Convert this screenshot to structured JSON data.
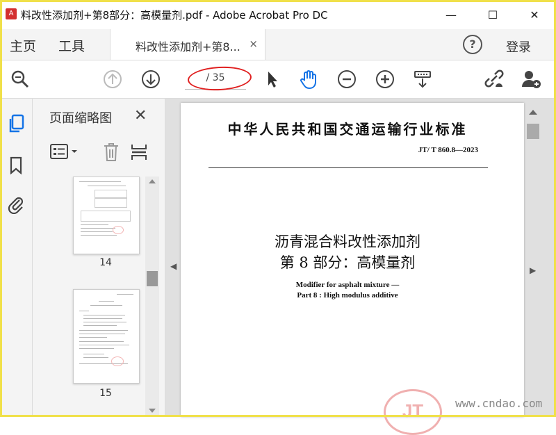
{
  "window": {
    "title": "料改性添加剂+第8部分：高模量剂.pdf - Adobe Acrobat Pro DC",
    "minimize": "—",
    "maximize": "☐",
    "close": "✕"
  },
  "tabs": {
    "home": "主页",
    "tools": "工具",
    "document": "料改性添加剂+第8...",
    "document_close": "×",
    "help": "?",
    "login": "登录"
  },
  "toolbar": {
    "page_indicator": "/ 35",
    "icons": [
      "search-icon",
      "prev-page-icon",
      "next-page-icon",
      "select-cursor-icon",
      "hand-tool-icon",
      "zoom-out-icon",
      "zoom-in-icon",
      "scroll-mode-icon",
      "share-link-icon",
      "add-user-icon"
    ],
    "highlight_color": "#e02020"
  },
  "sidebar": {
    "icons": [
      "page-thumbnails-icon",
      "bookmark-icon",
      "attachment-icon"
    ],
    "active_color": "#1473e6"
  },
  "thumbnails": {
    "title": "页面缩略图",
    "close": "✕",
    "tools": [
      "thumbnail-options-icon",
      "delete-page-icon",
      "page-layout-icon"
    ],
    "pages": [
      {
        "label": "14"
      },
      {
        "label": "15"
      }
    ]
  },
  "document": {
    "standard_title": "中华人民共和国交通运输行业标准",
    "standard_number": "JT/ T  860.8—2023",
    "title_cn_line1": "沥青混合料改性添加剂",
    "title_cn_line2": "第 8 部分：高模量剂",
    "title_en_line1": "Modifier for asphalt mixture —",
    "title_en_line2": "Part 8 : High modulus additive",
    "logo_text": "JT"
  },
  "watermark": "www.cndao.com"
}
